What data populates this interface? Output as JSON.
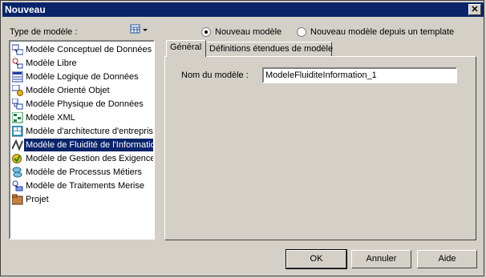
{
  "window": {
    "title": "Nouveau",
    "close_glyph": "✕"
  },
  "model_type": {
    "label": "Type de modèle :",
    "items": [
      {
        "label": "Modèle Conceptuel de Données",
        "icon": "conceptual-model-icon"
      },
      {
        "label": "Modèle Libre",
        "icon": "free-model-icon"
      },
      {
        "label": "Modèle Logique de Données",
        "icon": "logical-model-icon"
      },
      {
        "label": "Modèle Orienté Objet",
        "icon": "object-model-icon"
      },
      {
        "label": "Modèle Physique de Données",
        "icon": "physical-model-icon"
      },
      {
        "label": "Modèle XML",
        "icon": "xml-model-icon"
      },
      {
        "label": "Modèle d'architecture d'entreprise",
        "icon": "enterprise-architecture-icon"
      },
      {
        "label": "Modèle de Fluidité de l'Information",
        "icon": "information-flow-icon",
        "selected": true
      },
      {
        "label": "Modèle de Gestion des Exigences",
        "icon": "requirements-model-icon"
      },
      {
        "label": "Modèle de Processus Métiers",
        "icon": "business-process-icon"
      },
      {
        "label": "Modèle de Traitements Merise",
        "icon": "merise-model-icon"
      },
      {
        "label": "Projet",
        "icon": "project-icon"
      }
    ]
  },
  "radios": {
    "new_model": "Nouveau modèle",
    "from_template": "Nouveau modèle depuis un template"
  },
  "tabs": {
    "general": "Général",
    "extended": "Définitions étendues de modèle"
  },
  "form": {
    "name_label": "Nom du modèle :",
    "name_value": "ModeleFluiditeInformation_1"
  },
  "buttons": {
    "ok": "OK",
    "cancel": "Annuler",
    "help": "Aide"
  },
  "colors": {
    "title_bg": "#0a246a",
    "face": "#d4d0c8",
    "selection": "#0a246a"
  }
}
